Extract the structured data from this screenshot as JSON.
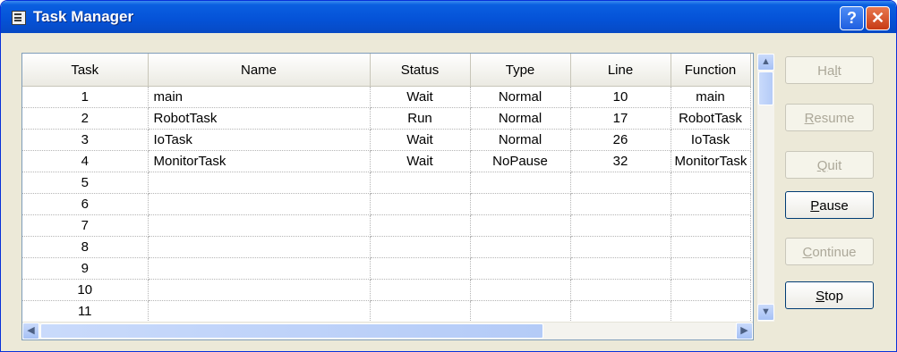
{
  "window": {
    "title": "Task Manager"
  },
  "table": {
    "columns": [
      "Task",
      "Name",
      "Status",
      "Type",
      "Line",
      "Function"
    ],
    "rows": [
      [
        "1",
        "main",
        "Wait",
        "Normal",
        "10",
        "main"
      ],
      [
        "2",
        "RobotTask",
        "Run",
        "Normal",
        "17",
        "RobotTask"
      ],
      [
        "3",
        "IoTask",
        "Wait",
        "Normal",
        "26",
        "IoTask"
      ],
      [
        "4",
        "MonitorTask",
        "Wait",
        "NoPause",
        "32",
        "MonitorTask"
      ],
      [
        "5",
        "",
        "",
        "",
        "",
        ""
      ],
      [
        "6",
        "",
        "",
        "",
        "",
        ""
      ],
      [
        "7",
        "",
        "",
        "",
        "",
        ""
      ],
      [
        "8",
        "",
        "",
        "",
        "",
        ""
      ],
      [
        "9",
        "",
        "",
        "",
        "",
        ""
      ],
      [
        "10",
        "",
        "",
        "",
        "",
        ""
      ],
      [
        "11",
        "",
        "",
        "",
        "",
        ""
      ]
    ]
  },
  "buttons": {
    "halt": {
      "pre": "Ha",
      "ul": "l",
      "post": "t",
      "enabled": false
    },
    "resume": {
      "pre": "",
      "ul": "R",
      "post": "esume",
      "enabled": false
    },
    "quit": {
      "pre": "",
      "ul": "Q",
      "post": "uit",
      "enabled": false
    },
    "pause": {
      "pre": "",
      "ul": "P",
      "post": "ause",
      "enabled": true
    },
    "continue": {
      "pre": "",
      "ul": "C",
      "post": "ontinue",
      "enabled": false
    },
    "stop": {
      "pre": "",
      "ul": "S",
      "post": "top",
      "enabled": true
    }
  },
  "icons": {
    "app": "window-icon",
    "help": "help-icon",
    "close": "close-icon",
    "scroll_up": "chevron-up-icon",
    "scroll_down": "chevron-down-icon",
    "scroll_left": "chevron-left-icon",
    "scroll_right": "chevron-right-icon"
  },
  "colors": {
    "titlebar": "#0553d8",
    "window_bg": "#ece9d8",
    "close_button": "#c73a14"
  }
}
